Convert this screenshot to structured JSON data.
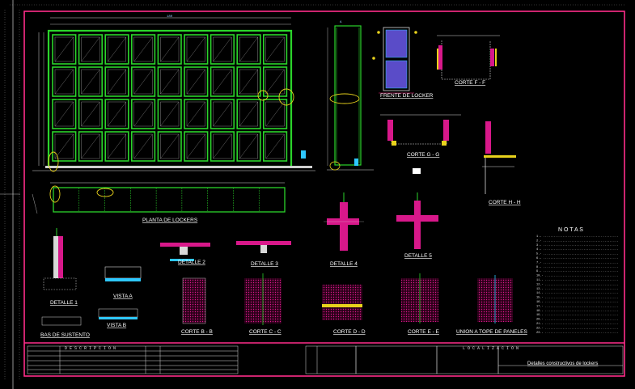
{
  "drawing": {
    "colors": {
      "background": "#000000",
      "frame": "#ff2d8a",
      "tank_wall": "#2bd42b",
      "dimension": "#d8d8d8",
      "section_fill": "#d8188a",
      "accent_cyan": "#2ec7ff",
      "accent_yellow": "#e8d21c",
      "accent_red": "#e02020",
      "panel_blue": "#5a4cc8"
    },
    "titles": {
      "plan": "PLANTA DE LOCKERS",
      "front": "FRENTE DE LOCKER",
      "corte_ff": "CORTE F - F",
      "corte_gg": "CORTE G - G",
      "corte_hh": "CORTE H - H",
      "detalle_1": "DETALLE 1",
      "detalle_2": "DETALLE 2",
      "detalle_3": "DETALLE 3",
      "detalle_4": "DETALLE 4",
      "detalle_5": "DETALLE 5",
      "base": "BAS DE SUSTENTO",
      "vista_a": "VISTA A",
      "vista_b": "VISTA B",
      "corte_bb": "CORTE B - B",
      "corte_cc": "CORTE C - C",
      "corte_dd": "CORTE D - D",
      "corte_ee": "CORTE E - E",
      "union": "UNION A TOPE DE PANELES"
    },
    "notes": {
      "heading": "N O T A S",
      "lines": [
        "1.- ...........................................",
        "2.- ...........................................",
        "3.- ...........................................",
        "4.- ...........................................",
        "5.- ...........................................",
        "6.- ...........................................",
        "7.- ...........................................",
        "8.- ...........................................",
        "9.- ...........................................",
        "10.- ..........................................",
        "11.- ..........................................",
        "12.- ..........................................",
        "13.- ..........................................",
        "14.- ..........................................",
        "15.- ..........................................",
        "16.- ..........................................",
        "17.- ..........................................",
        "18.- ..........................................",
        "19.- ..........................................",
        "20.- ..........................................",
        "21.- ..........................................",
        "22.- ..........................................",
        "23.- .........................................."
      ]
    },
    "title_block": {
      "project_title": "Detalles constructivos de lockers",
      "header_left": "D E S C R I P C I O N",
      "header_right": "L O C A L I Z A C I O N"
    }
  }
}
